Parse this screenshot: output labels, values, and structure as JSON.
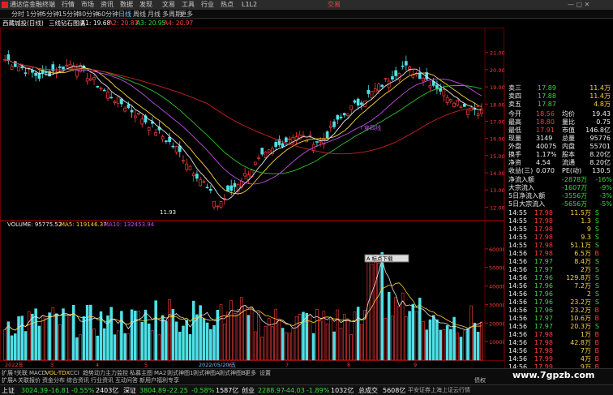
{
  "titlebar": {
    "app_name": "通达信金融终端",
    "menus": [
      "行情",
      "市场",
      "资讯",
      "数据",
      "发现",
      "文易",
      "工具",
      "行业",
      "热点",
      "L1L2"
    ],
    "trade_label": "交易"
  },
  "toolbar": {
    "periods": [
      "分时",
      "1分钟",
      "5分钟",
      "15分钟",
      "30分钟",
      "60分钟",
      "日线",
      "周线",
      "月线",
      "多周期",
      "更多"
    ],
    "active_period": "日线"
  },
  "infoline": {
    "stock": "西藏城投(日线)",
    "indicator": "三线钻石图底",
    "a1": "A1: 19.68",
    "a2": "A2: 20.87",
    "a3": "A3: 20.95",
    "a4": "A4: 20.97"
  },
  "main_chart": {
    "y_ticks": [
      "21.00",
      "20.00",
      "19.00",
      "18.00",
      "17.00",
      "16.00",
      "15.00",
      "14.00",
      "13.00",
      "12.00"
    ],
    "low_label": "11.93",
    "signal_label": "↑穿四线"
  },
  "volume_chart": {
    "header_volume": "VOLUME: 95775.52",
    "header_ma5": "MA5: 119146.37",
    "header_ma10": "MA10: 132453.94",
    "y_ticks": [
      "60000",
      "50000",
      "40000",
      "30000",
      "20000",
      "10000"
    ],
    "popup_label": "A 标点下载"
  },
  "x_axis": {
    "labels": [
      "2022年",
      "3",
      "4",
      "5",
      "2022/05/20/五",
      "6",
      "7",
      "8",
      "9"
    ]
  },
  "colors": {
    "up": "#ff3c3c",
    "down": "#4fe0e8",
    "ma_white": "#e6e6e6",
    "ma_yellow": "#ffd23c",
    "ma_purple": "#c050e0",
    "ma_green": "#30c030",
    "ma_red": "#d02020"
  },
  "right_panel": {
    "order_book": [
      {
        "label": "卖三",
        "price": "17.89",
        "vol": "11.4万"
      },
      {
        "label": "卖四",
        "price": "17.88",
        "vol": "11.4万"
      },
      {
        "label": "卖五",
        "price": "17.87",
        "vol": "4.8万"
      }
    ],
    "stats": [
      {
        "l1": "今开",
        "v1": "18.56",
        "l2": "均价",
        "v2": "19.43"
      },
      {
        "l1": "最高",
        "v1": "18.80",
        "l2": "量比",
        "v2": "0.75"
      },
      {
        "l1": "最低",
        "v1": "17.91",
        "l2": "市值",
        "v2": "146.8亿"
      },
      {
        "l1": "现量",
        "v1": "3149",
        "l2": "总量",
        "v2": "95776"
      },
      {
        "l1": "外盘",
        "v1": "40075",
        "l2": "内盘",
        "v2": "55701"
      },
      {
        "l1": "换手",
        "v1": "1.17%",
        "l2": "股本",
        "v2": "8.20亿"
      },
      {
        "l1": "净资",
        "v1": "4.54",
        "l2": "流通",
        "v2": "8.20亿"
      },
      {
        "l1": "收益(三)",
        "v1": "0.070",
        "l2": "PE(动)",
        "v2": "130.5"
      }
    ],
    "flows": [
      {
        "label": "净流入额",
        "value": "-2878万",
        "pct": "-16%"
      },
      {
        "label": "大宗流入",
        "value": "-1607万",
        "pct": "-9%"
      },
      {
        "label": "5日净流入额",
        "value": "-3556万",
        "pct": "-3%"
      },
      {
        "label": "5日大宗流入",
        "value": "-5656万",
        "pct": "-5%"
      }
    ],
    "ticks": [
      {
        "time": "14:55",
        "price": "17.98",
        "vol": "11.5万",
        "dir": "S"
      },
      {
        "time": "14:55",
        "price": "17.98",
        "vol": "1.3",
        "dir": "S"
      },
      {
        "time": "14:55",
        "price": "17.98",
        "vol": "9",
        "dir": "S"
      },
      {
        "time": "14:55",
        "price": "17.98",
        "vol": "9.3",
        "dir": "S"
      },
      {
        "time": "14:55",
        "price": "17.98",
        "vol": "51.1万",
        "dir": "S"
      },
      {
        "time": "14:56",
        "price": "17.98",
        "vol": "6.5万",
        "dir": "B"
      },
      {
        "time": "14:56",
        "price": "17.97",
        "vol": "8.4万",
        "dir": "S"
      },
      {
        "time": "14:56",
        "price": "17.97",
        "vol": "2万",
        "dir": "S"
      },
      {
        "time": "14:56",
        "price": "17.96",
        "vol": "129.8万",
        "dir": "S"
      },
      {
        "time": "14:56",
        "price": "17.96",
        "vol": "7.2万",
        "dir": "S"
      },
      {
        "time": "14:56",
        "price": "17.96",
        "vol": "2",
        "dir": "S"
      },
      {
        "time": "14:56",
        "price": "17.96",
        "vol": "23.2万",
        "dir": "S"
      },
      {
        "time": "14:56",
        "price": "17.96",
        "vol": "23.2万",
        "dir": "B"
      },
      {
        "time": "14:56",
        "price": "17.97",
        "vol": "10.6万",
        "dir": "B"
      },
      {
        "time": "14:56",
        "price": "17.97",
        "vol": "20.3万",
        "dir": "S"
      },
      {
        "time": "14:56",
        "price": "17.98",
        "vol": "1万",
        "dir": "B"
      },
      {
        "time": "14:56",
        "price": "17.98",
        "vol": "42.8万",
        "dir": "B"
      },
      {
        "time": "14:56",
        "price": "17.98",
        "vol": "7万",
        "dir": "B"
      },
      {
        "time": "14:56",
        "price": "17.99",
        "vol": "4万",
        "dir": "B"
      },
      {
        "time": "14:56",
        "price": "17.99",
        "vol": "9万",
        "dir": "B"
      }
    ]
  },
  "bottom_tabs": {
    "items": [
      "扩展↑",
      "关联",
      "MACD",
      "VOL-TDX",
      "CCI",
      "趋势动力",
      "主力监控",
      "私募主图",
      "MA2",
      "则式神图1",
      "则式神图A",
      "则式神图B",
      "更多",
      "设置"
    ]
  },
  "sub_tabs": {
    "items": [
      "扩展A",
      "关联报价",
      "资金分布",
      "综合资讯",
      "行业资讯",
      "互动问答",
      "新用户福利专享"
    ],
    "right": "债权"
  },
  "statusbar": {
    "sh_label": "上证",
    "sh_val": "3024.39",
    "sh_chg": "-16.81",
    "sh_pct": "-0.55%",
    "sh_amt": "2403亿",
    "sz_label": "深证",
    "sz_val": "3804.89",
    "sz_chg": "-22.25",
    "sz_pct": "-0.58%",
    "sz_amt": "1587亿",
    "cy_label": "创业",
    "cy_val": "2288.97",
    "cy_chg": "-44.03",
    "cy_pct": "-1.89%",
    "cy_amt": "1032亿",
    "total_label": "总成交",
    "total_val": "5608亿",
    "news": "平安证券上海上证云行情"
  },
  "watermark": "www.7gpzb.com"
}
